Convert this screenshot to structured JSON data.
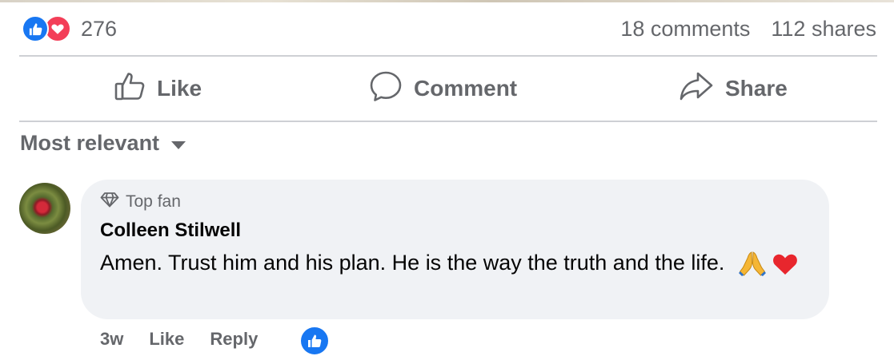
{
  "post_stats": {
    "reaction_count": "276",
    "reaction_icons": [
      "like-icon",
      "love-icon"
    ],
    "comments": "18 comments",
    "shares": "112 shares"
  },
  "actions": {
    "like": "Like",
    "comment": "Comment",
    "share": "Share"
  },
  "sort": {
    "label": "Most relevant",
    "icon": "caret-down-icon"
  },
  "comment": {
    "badge": "Top fan",
    "author": "Colleen Stilwell",
    "text": "Amen. Trust him and his plan. He is the way the truth and the life.",
    "emojis": [
      "praying-hands-icon",
      "red-heart-icon"
    ],
    "time": "3w",
    "like": "Like",
    "reply": "Reply",
    "reaction_icon": "like-icon"
  },
  "colors": {
    "brand_blue": "#1877f2",
    "love_red": "#f33e58",
    "muted_text": "#65676b",
    "bubble_bg": "#f0f2f5",
    "divider": "#ced0d4"
  }
}
